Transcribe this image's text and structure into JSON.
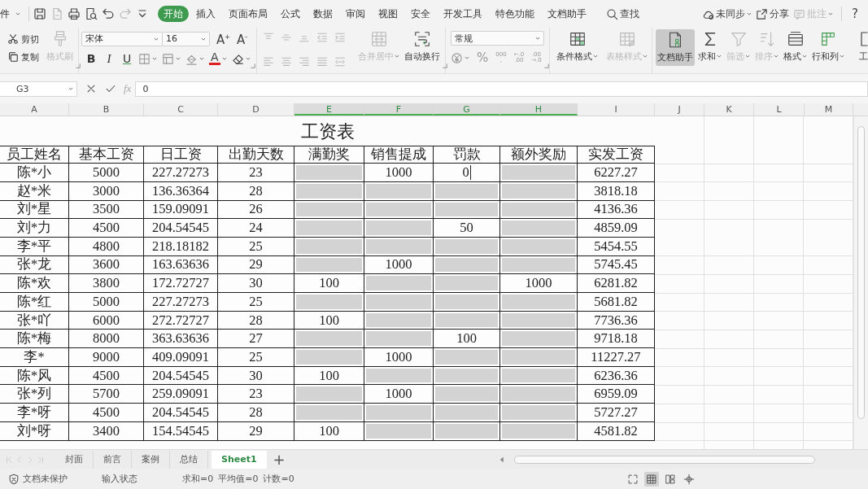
{
  "menu_bar": {
    "file_menu": "件",
    "quick_access": [
      {
        "kind": "save",
        "disabled": false
      },
      {
        "kind": "export",
        "disabled": true
      },
      {
        "kind": "print",
        "disabled": false
      },
      {
        "kind": "preview",
        "disabled": false
      },
      {
        "kind": "undo",
        "disabled": false
      },
      {
        "kind": "redo",
        "disabled": true
      },
      {
        "kind": "customize",
        "disabled": false
      }
    ],
    "tabs": [
      {
        "label": "开始",
        "selected": true
      },
      {
        "label": "插入",
        "selected": false
      },
      {
        "label": "页面布局",
        "selected": false
      },
      {
        "label": "公式",
        "selected": false
      },
      {
        "label": "数据",
        "selected": false
      },
      {
        "label": "审阅",
        "selected": false
      },
      {
        "label": "视图",
        "selected": false
      },
      {
        "label": "安全",
        "selected": false
      },
      {
        "label": "开发工具",
        "selected": false
      },
      {
        "label": "特色功能",
        "selected": false
      },
      {
        "label": "文档助手",
        "selected": false
      }
    ],
    "search": "查找",
    "sync": "未同步",
    "share": "分享",
    "comment": {
      "label": "批注",
      "disabled": true
    },
    "help": "?"
  },
  "ribbon": {
    "clipboard": {
      "cut": "剪切",
      "copy": "复制",
      "format_painter": {
        "label": "格式刷",
        "disabled": true
      }
    },
    "font": {
      "family": "宋体",
      "size": "16",
      "grow": "A$^{+}$",
      "shrink": "A$^{-}$",
      "bold": "B",
      "italic": "I",
      "underline": "U",
      "font_color_button": "A"
    },
    "alignment": {
      "disabled": true,
      "merge": {
        "label": "合并居中",
        "disabled": true
      },
      "wrap": {
        "label": "自动换行",
        "disabled": false
      }
    },
    "number": {
      "format": "常规",
      "percent": "%",
      "thousands": [
        "000",
        ","
      ],
      "add_decimal": [
        "←.0",
        ".00"
      ],
      "remove_decimal": [
        ".00",
        "→.0"
      ]
    },
    "styles": [
      {
        "kind": "conditional",
        "label": "条件格式",
        "disabled": false,
        "menu": true
      },
      {
        "kind": "table",
        "label": "表格样式",
        "disabled": true,
        "menu": true
      }
    ],
    "tools": [
      {
        "kind": "assistant",
        "label": "文档助手",
        "selected": true,
        "disabled": false,
        "menu": false
      },
      {
        "kind": "sum",
        "label": "求和",
        "selected": false,
        "disabled": false,
        "menu": true
      },
      {
        "kind": "filter",
        "label": "筛选",
        "selected": false,
        "disabled": true,
        "menu": true
      },
      {
        "kind": "sort",
        "label": "排序",
        "selected": false,
        "disabled": true,
        "menu": true
      },
      {
        "kind": "format",
        "label": "格式",
        "selected": false,
        "disabled": false,
        "menu": true
      },
      {
        "kind": "rowscols",
        "label": "行和列",
        "selected": false,
        "disabled": false,
        "menu": true
      },
      {
        "kind": "sheet",
        "label": "工",
        "selected": false,
        "disabled": false,
        "menu": false
      }
    ]
  },
  "formula_bar": {
    "cell_ref": "G3",
    "function_label": "fx",
    "value": "0"
  },
  "columns": [
    {
      "label": "A",
      "selected": false
    },
    {
      "label": "B",
      "selected": false
    },
    {
      "label": "C",
      "selected": false
    },
    {
      "label": "D",
      "selected": false
    },
    {
      "label": "E",
      "selected": true
    },
    {
      "label": "F",
      "selected": true
    },
    {
      "label": "G",
      "selected": true
    },
    {
      "label": "H",
      "selected": true
    },
    {
      "label": "I",
      "selected": false
    },
    {
      "label": "J",
      "selected": false
    },
    {
      "label": "K",
      "selected": false
    },
    {
      "label": "L",
      "selected": false
    },
    {
      "label": "M",
      "selected": false
    }
  ],
  "sheet": {
    "title": "工资表",
    "headers": [
      "员工姓名",
      "基本工资",
      "日工资",
      "出勤天数",
      "满勤奖",
      "销售提成",
      "罚款",
      "额外奖励",
      "实发工资"
    ],
    "rows": [
      {
        "name": "陈*小",
        "base_pay": "5000",
        "daily_pay": "227.27273",
        "days": "23",
        "adjustments": [
          {
            "selected": true,
            "editing": false
          },
          {
            "text": "1000",
            "selected": false,
            "editing": false
          },
          {
            "text": "0",
            "selected": false,
            "editing": true
          },
          {
            "selected": true,
            "editing": false
          }
        ],
        "net_pay": "6227.27"
      },
      {
        "name": "赵*米",
        "base_pay": "3000",
        "daily_pay": "136.36364",
        "days": "28",
        "adjustments": [
          {
            "selected": true,
            "editing": false
          },
          {
            "selected": true,
            "editing": false
          },
          {
            "selected": true,
            "editing": false
          },
          {
            "selected": true,
            "editing": false
          }
        ],
        "net_pay": "3818.18"
      },
      {
        "name": "刘*星",
        "base_pay": "3500",
        "daily_pay": "159.09091",
        "days": "26",
        "adjustments": [
          {
            "selected": true,
            "editing": false
          },
          {
            "selected": true,
            "editing": false
          },
          {
            "selected": true,
            "editing": false
          },
          {
            "selected": true,
            "editing": false
          }
        ],
        "net_pay": "4136.36"
      },
      {
        "name": "刘*力",
        "base_pay": "4500",
        "daily_pay": "204.54545",
        "days": "24",
        "adjustments": [
          {
            "selected": true,
            "editing": false
          },
          {
            "selected": true,
            "editing": false
          },
          {
            "text": "50",
            "selected": false,
            "editing": false
          },
          {
            "selected": true,
            "editing": false
          }
        ],
        "net_pay": "4859.09"
      },
      {
        "name": "李*平",
        "base_pay": "4800",
        "daily_pay": "218.18182",
        "days": "25",
        "adjustments": [
          {
            "selected": true,
            "editing": false
          },
          {
            "selected": true,
            "editing": false
          },
          {
            "selected": true,
            "editing": false
          },
          {
            "selected": true,
            "editing": false
          }
        ],
        "net_pay": "5454.55"
      },
      {
        "name": "张*龙",
        "base_pay": "3600",
        "daily_pay": "163.63636",
        "days": "29",
        "adjustments": [
          {
            "selected": true,
            "editing": false
          },
          {
            "text": "1000",
            "selected": false,
            "editing": false
          },
          {
            "selected": true,
            "editing": false
          },
          {
            "selected": true,
            "editing": false
          }
        ],
        "net_pay": "5745.45"
      },
      {
        "name": "陈*欢",
        "base_pay": "3800",
        "daily_pay": "172.72727",
        "days": "30",
        "adjustments": [
          {
            "text": "100",
            "selected": false,
            "editing": false
          },
          {
            "selected": true,
            "editing": false
          },
          {
            "selected": true,
            "editing": false
          },
          {
            "text": "1000",
            "selected": false,
            "editing": false
          }
        ],
        "net_pay": "6281.82"
      },
      {
        "name": "陈*红",
        "base_pay": "5000",
        "daily_pay": "227.27273",
        "days": "25",
        "adjustments": [
          {
            "selected": true,
            "editing": false
          },
          {
            "selected": true,
            "editing": false
          },
          {
            "selected": true,
            "editing": false
          },
          {
            "selected": true,
            "editing": false
          }
        ],
        "net_pay": "5681.82"
      },
      {
        "name": "张*吖",
        "base_pay": "6000",
        "daily_pay": "272.72727",
        "days": "28",
        "adjustments": [
          {
            "text": "100",
            "selected": false,
            "editing": false
          },
          {
            "selected": true,
            "editing": false
          },
          {
            "selected": true,
            "editing": false
          },
          {
            "selected": true,
            "editing": false
          }
        ],
        "net_pay": "7736.36"
      },
      {
        "name": "陈*梅",
        "base_pay": "8000",
        "daily_pay": "363.63636",
        "days": "27",
        "adjustments": [
          {
            "selected": true,
            "editing": false
          },
          {
            "selected": true,
            "editing": false
          },
          {
            "text": "100",
            "selected": false,
            "editing": false
          },
          {
            "selected": true,
            "editing": false
          }
        ],
        "net_pay": "9718.18"
      },
      {
        "name": "李*",
        "base_pay": "9000",
        "daily_pay": "409.09091",
        "days": "25",
        "adjustments": [
          {
            "selected": true,
            "editing": false
          },
          {
            "text": "1000",
            "selected": false,
            "editing": false
          },
          {
            "selected": true,
            "editing": false
          },
          {
            "selected": true,
            "editing": false
          }
        ],
        "net_pay": "11227.27"
      },
      {
        "name": "陈*风",
        "base_pay": "4500",
        "daily_pay": "204.54545",
        "days": "30",
        "adjustments": [
          {
            "text": "100",
            "selected": false,
            "editing": false
          },
          {
            "selected": true,
            "editing": false
          },
          {
            "selected": true,
            "editing": false
          },
          {
            "selected": true,
            "editing": false
          }
        ],
        "net_pay": "6236.36"
      },
      {
        "name": "张*列",
        "base_pay": "5700",
        "daily_pay": "259.09091",
        "days": "23",
        "adjustments": [
          {
            "selected": true,
            "editing": false
          },
          {
            "text": "1000",
            "selected": false,
            "editing": false
          },
          {
            "selected": true,
            "editing": false
          },
          {
            "selected": true,
            "editing": false
          }
        ],
        "net_pay": "6959.09"
      },
      {
        "name": "李*呀",
        "base_pay": "4500",
        "daily_pay": "204.54545",
        "days": "28",
        "adjustments": [
          {
            "selected": true,
            "editing": false
          },
          {
            "selected": true,
            "editing": false
          },
          {
            "selected": true,
            "editing": false
          },
          {
            "selected": true,
            "editing": false
          }
        ],
        "net_pay": "5727.27"
      },
      {
        "name": "刘*呀",
        "base_pay": "3400",
        "daily_pay": "154.54545",
        "days": "29",
        "adjustments": [
          {
            "text": "100",
            "selected": false,
            "editing": false
          },
          {
            "selected": true,
            "editing": false
          },
          {
            "selected": true,
            "editing": false
          },
          {
            "selected": true,
            "editing": false
          }
        ],
        "net_pay": "4581.82"
      }
    ]
  },
  "sheet_bar": {
    "tabs": [
      {
        "label": "封面",
        "selected": false
      },
      {
        "label": "前言",
        "selected": false
      },
      {
        "label": "案例",
        "selected": false
      },
      {
        "label": "总结",
        "selected": false
      },
      {
        "label": "Sheet1",
        "selected": true
      }
    ],
    "add": "+"
  },
  "status_bar": {
    "protection": "文档未保护",
    "mode": "输入状态",
    "sum": "求和=0",
    "average": "平均值=0",
    "count": "计数=0",
    "views": [
      {
        "kind": "fullscreen",
        "selected": false
      },
      {
        "kind": "normal",
        "selected": true
      },
      {
        "kind": "pagebreak",
        "selected": false
      },
      {
        "kind": "reading",
        "selected": false
      }
    ]
  }
}
